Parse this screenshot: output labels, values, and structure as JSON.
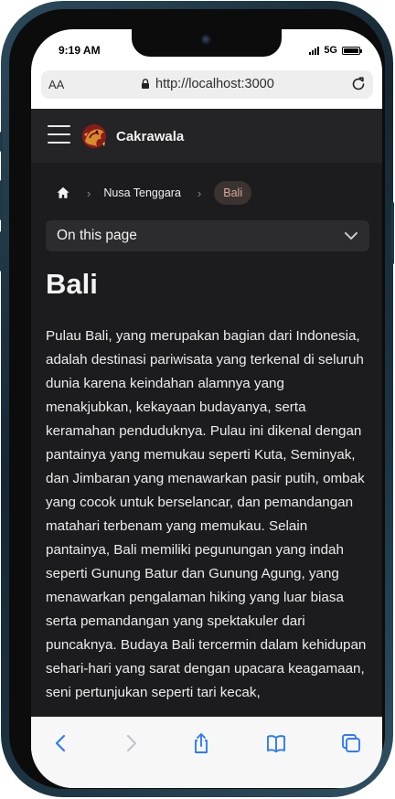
{
  "status_bar": {
    "time": "9:19 AM",
    "network": "5G",
    "battery_percent": 100
  },
  "url_bar": {
    "text_size_label": "AA",
    "url": "http://localhost:3000"
  },
  "site": {
    "brand": "Cakrawala",
    "breadcrumb": {
      "items": [
        {
          "label": "Nusa Tenggara"
        }
      ],
      "current": "Bali"
    },
    "on_this_page": "On this page",
    "page_title": "Bali",
    "article": "Pulau Bali, yang merupakan bagian dari Indonesia, adalah destinasi pariwisata yang terkenal di seluruh dunia karena keindahan alamnya yang menakjubkan, kekayaan budayanya, serta keramahan penduduknya. Pulau ini dikenal dengan pantainya yang memukau seperti Kuta, Seminyak, dan Jimbaran yang menawarkan pasir putih, ombak yang cocok untuk berselancar, dan pemandangan matahari terbenam yang memukau. Selain pantainya, Bali memiliki pegunungan yang indah seperti Gunung Batur dan Gunung Agung, yang menawarkan pengalaman hiking yang luar biasa serta pemandangan yang spektakuler dari puncaknya. Budaya Bali tercermin dalam kehidupan sehari-hari yang sarat dengan upacara keagamaan, seni pertunjukan seperti tari kecak,"
  },
  "toolbar": {
    "icons": [
      "back-icon",
      "forward-icon",
      "share-icon",
      "bookmarks-icon",
      "tabs-icon"
    ]
  },
  "colors": {
    "page_background": "#1c1c1e",
    "header_background": "#242426",
    "accent_text": "#d9a998",
    "device_frame": "#1d3442",
    "link_blue": "#2f7bf6"
  }
}
